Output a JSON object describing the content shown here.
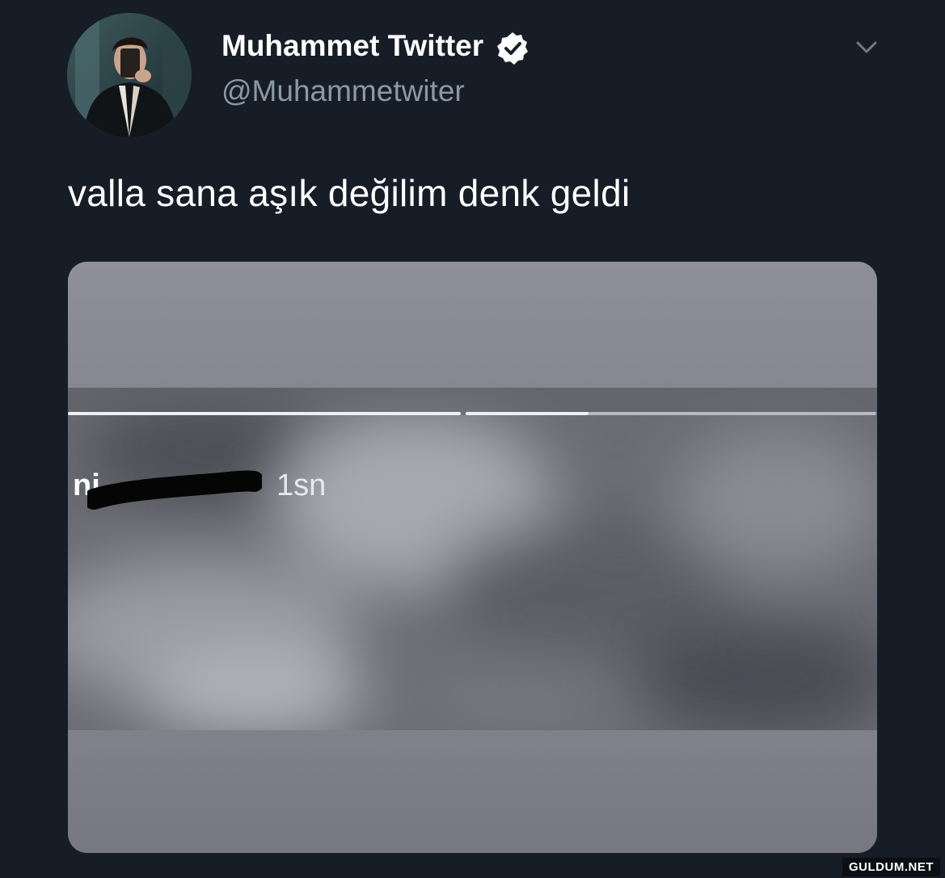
{
  "tweet": {
    "display_name": "Muhammet Twitter",
    "handle": "@Muhammetwiter",
    "verified": true,
    "text": "valla sana aşık değilim denk geldi"
  },
  "media": {
    "story_username": "ni",
    "story_time": "1sn",
    "story_progress": [
      1.0,
      0.3
    ]
  },
  "icons": {
    "verified": "verified-badge-icon",
    "more": "chevron-down-icon"
  },
  "watermark": "GULDUM.NET",
  "colors": {
    "background": "#161d27",
    "handle_gray": "#8b98a5",
    "text_white": "#ffffff"
  }
}
